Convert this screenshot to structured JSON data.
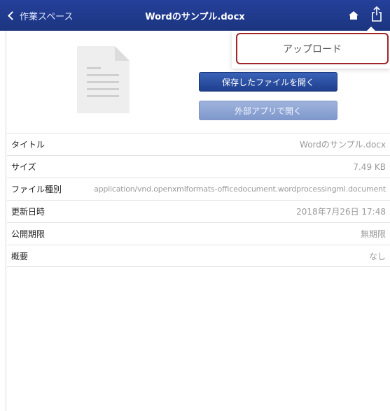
{
  "navbar": {
    "back_label": "作業スペース",
    "title": "Wordのサンプル.docx",
    "home_icon": "home-icon",
    "share_icon": "share-icon"
  },
  "popover": {
    "upload_label": "アップロード"
  },
  "actions": {
    "open_saved_label": "保存したファイルを開く",
    "open_external_label": "外部アプリで開く"
  },
  "details": [
    {
      "label": "タイトル",
      "value": "Wordのサンプル.docx"
    },
    {
      "label": "サイズ",
      "value": "7.49 KB"
    },
    {
      "label": "ファイル種別",
      "value": "application/vnd.openxmlformats-officedocument.wordprocessingml.document"
    },
    {
      "label": "更新日時",
      "value": "2018年7月26日 17:48"
    },
    {
      "label": "公開期限",
      "value": "無期限"
    },
    {
      "label": "概要",
      "value": "なし"
    }
  ],
  "colors": {
    "navbar": "#1f3a8a",
    "upload_highlight": "#a0262a",
    "primary_button": "#2a4fa3",
    "disabled_button": "#8ea4d4"
  }
}
